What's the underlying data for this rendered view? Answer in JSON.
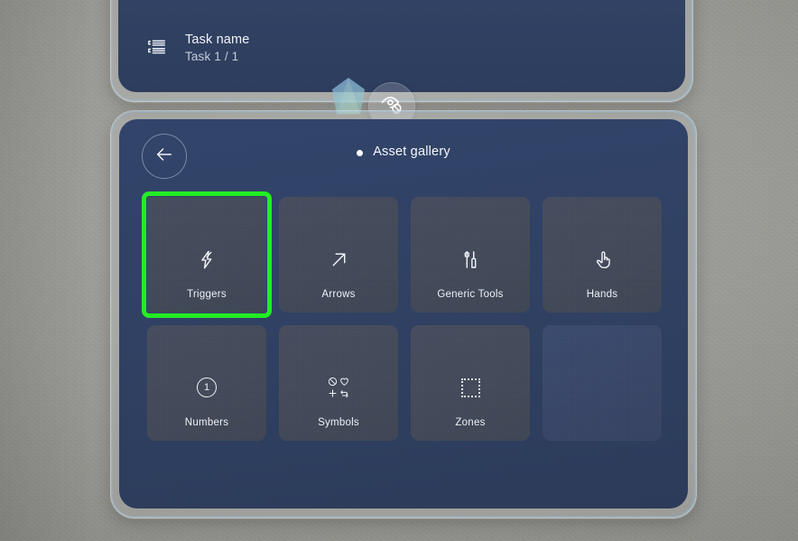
{
  "colors": {
    "wall": "#9b9b96",
    "panel_blue": "#304163",
    "tile_slate": "#424959",
    "empty_tile_blue": "#374567",
    "selection_green": "#23ed23",
    "text_primary": "#f2f4f8",
    "text_secondary": "#c2cada"
  },
  "task_card": {
    "icon": "task-list-icon",
    "title": "Task name",
    "subtitle": "Task 1 / 1"
  },
  "floating_controls": {
    "gem": {
      "icon": "gem-crystal-icon"
    },
    "eye_toggle": {
      "icon": "eye-off-icon"
    }
  },
  "gallery": {
    "back_button": {
      "icon": "arrow-left-icon"
    },
    "title": "Asset gallery",
    "tiles": [
      {
        "label": "Triggers",
        "icon": "lightning-bolt-icon",
        "selected": true,
        "empty": false
      },
      {
        "label": "Arrows",
        "icon": "arrow-up-right-icon",
        "selected": false,
        "empty": false
      },
      {
        "label": "Generic Tools",
        "icon": "tools-icon",
        "selected": false,
        "empty": false
      },
      {
        "label": "Hands",
        "icon": "pointing-hand-icon",
        "selected": false,
        "empty": false
      },
      {
        "label": "Numbers",
        "icon": "circled-one-icon",
        "selected": false,
        "empty": false,
        "glyph": "1"
      },
      {
        "label": "Symbols",
        "icon": "symbols-grid-icon",
        "selected": false,
        "empty": false
      },
      {
        "label": "Zones",
        "icon": "dotted-square-icon",
        "selected": false,
        "empty": false
      },
      {
        "label": "",
        "icon": "",
        "selected": false,
        "empty": true
      }
    ]
  }
}
